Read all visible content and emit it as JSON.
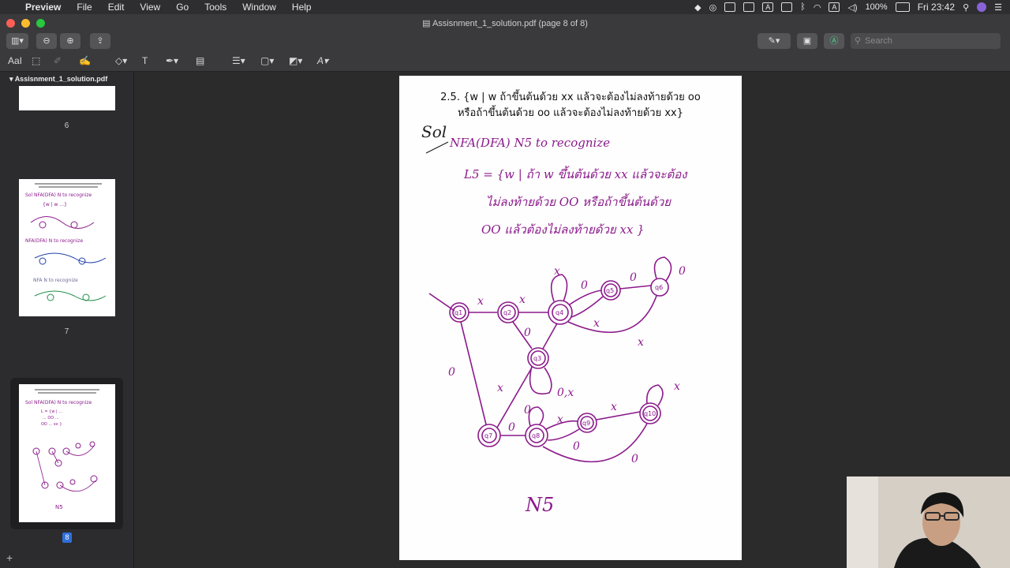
{
  "menubar": {
    "app": "Preview",
    "items": [
      "File",
      "Edit",
      "View",
      "Go",
      "Tools",
      "Window",
      "Help"
    ],
    "battery": "100%",
    "clock": "Fri 23:42"
  },
  "window": {
    "title": "Assisnment_1_solution.pdf (page 8 of 8)"
  },
  "toolbar": {
    "search_placeholder": "Search",
    "text_tool_label": "AaI"
  },
  "sidebar": {
    "file_name": "Assisnment_1_solution.pdf",
    "pages": [
      {
        "label": "6"
      },
      {
        "label": "7"
      },
      {
        "label": "8",
        "selected": true
      }
    ]
  },
  "document": {
    "heading_line1": "2.5. {w | w ถ้าขึ้นต้นด้วย xx แล้วจะต้องไม่ลงท้ายด้วย oo",
    "heading_line2": "หรือถ้าขึ้นต้นด้วย oo แล้วจะต้องไม่ลงท้ายด้วย xx}",
    "handwriting": {
      "sol": "Sol",
      "line1": "NFA(DFA) N5 to recognize",
      "line2": "L5 = {w | ถ้า w ขึ้นต้นด้วย xx แล้วจะต้อง",
      "line3": "ไม่ลงท้ายด้วย OO หรือถ้าขึ้นต้นด้วย",
      "line4": "OO แล้วต้องไม่ลงท้ายด้วย xx }",
      "caption": "N5"
    },
    "states": [
      "q1",
      "q2",
      "q3",
      "q4",
      "q5",
      "q6",
      "q7",
      "q8",
      "q9",
      "q10"
    ],
    "ink_color": "#8b1a8b"
  }
}
